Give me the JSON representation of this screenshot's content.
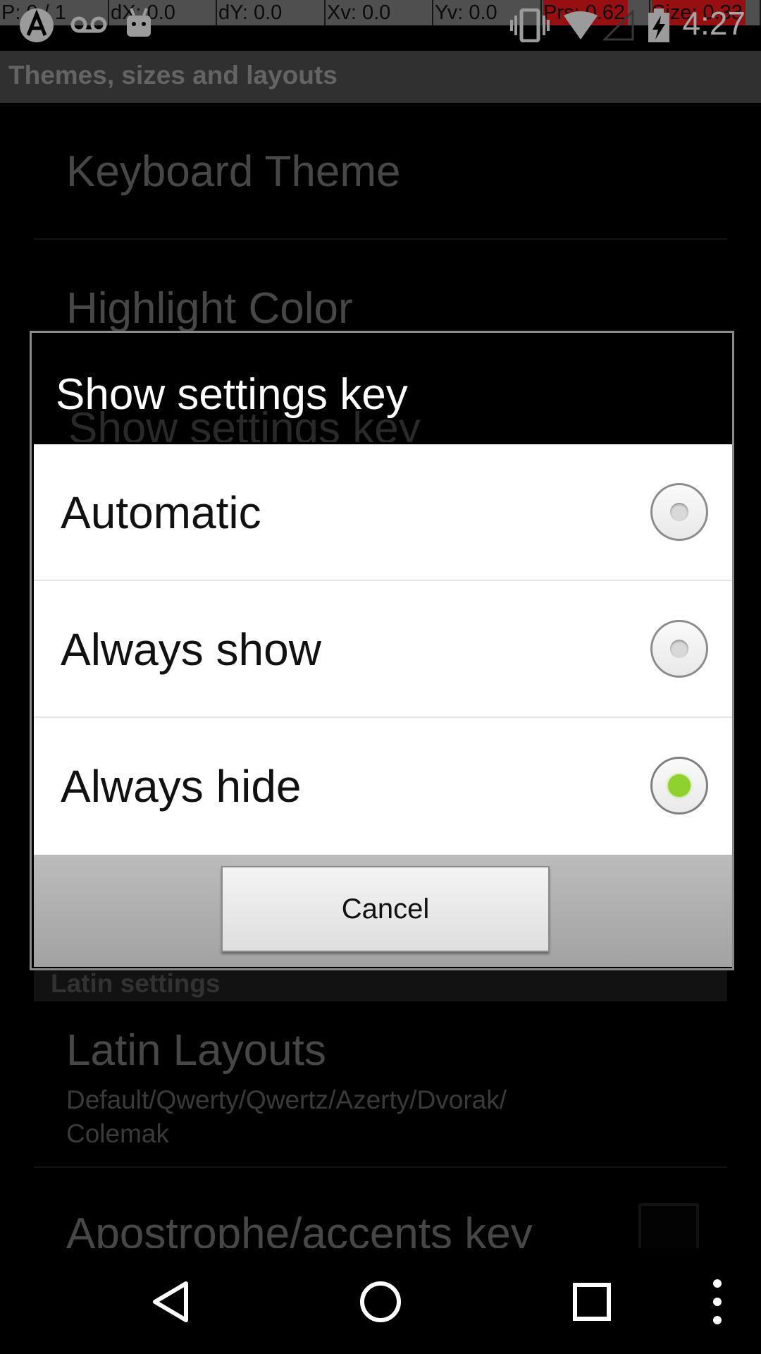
{
  "status_bar": {
    "pointer": "P: 0 / 1",
    "dx": "dX: 0.0",
    "dy": "dY: 0.0",
    "xv": "Xv: 0.0",
    "yv": "Yv: 0.0",
    "prs": "Prs: 0.62",
    "size": "Size: 0.33",
    "time": "4:27",
    "icons": [
      "debug-app-icon",
      "voicemail-icon",
      "android-icon",
      "vibrate-icon",
      "wifi-icon",
      "signal-icon",
      "battery-charging-icon"
    ],
    "highlight_color": "#e8191b"
  },
  "action_bar": {
    "title": "Themes, sizes and layouts"
  },
  "background_preferences": {
    "keyboard_theme": "Keyboard Theme",
    "highlight_color": "Highlight Color",
    "show_settings_key": "Show settings key",
    "category_latin": "Latin settings",
    "latin_layouts_title": "Latin Layouts",
    "latin_layouts_summary": "Default/Qwerty/Qwertz/Azerty/Dvorak/ Colemak",
    "apostrophe_key": "Apostrophe/accents key"
  },
  "dialog": {
    "title": "Show settings key",
    "options": [
      {
        "label": "Automatic",
        "checked": false
      },
      {
        "label": "Always show",
        "checked": false
      },
      {
        "label": "Always hide",
        "checked": true
      }
    ],
    "cancel_label": "Cancel",
    "accent_color": "#8fd12e"
  },
  "nav_bar": {
    "icons": [
      "back-icon",
      "home-icon",
      "recents-icon",
      "overflow-menu-icon"
    ]
  }
}
